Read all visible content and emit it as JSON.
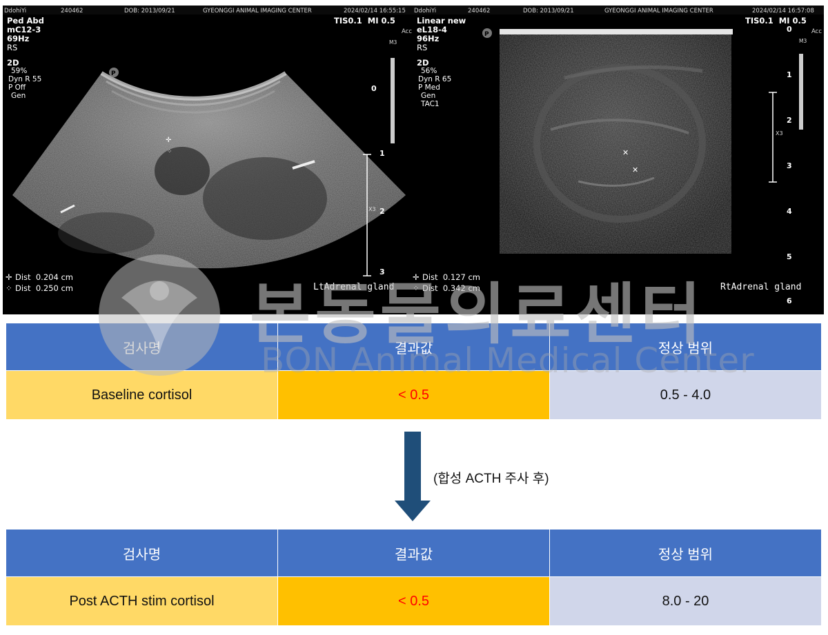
{
  "ultrasound_left": {
    "patient": "DdohiYi",
    "id": "240462",
    "dob": "DOB: 2013/09/21",
    "center": "GYEONGGI ANIMAL IMAGING CENTER",
    "timestamp": "2024/02/14 16:55:15",
    "preset": "Ped Abd",
    "probe": "mC12-3",
    "frame_rate": "69Hz",
    "orientation": "RS",
    "mode": "2D",
    "gain": "59%",
    "dyn_range": "Dyn R 55",
    "p_setting": "P Off",
    "gen": "Gen",
    "tis_mi": "TIS0.1  MI 0.5",
    "acc": "Acc",
    "map": "M3",
    "dist1": "Dist  0.204 cm",
    "dist2": "Dist  0.250 cm",
    "label": "LtAdrenal gland",
    "scale_ticks": [
      "0",
      "1",
      "2",
      "3"
    ],
    "zoom_marker": "X3"
  },
  "ultrasound_right": {
    "patient": "DdohiYi",
    "id": "240462",
    "dob": "DOB: 2013/09/21",
    "center": "GYEONGGI ANIMAL IMAGING CENTER",
    "timestamp": "2024/02/14 16:57:08",
    "preset": "Linear new",
    "probe": "eL18-4",
    "frame_rate": "96Hz",
    "orientation": "RS",
    "mode": "2D",
    "gain": "56%",
    "dyn_range": "Dyn R 65",
    "p_setting": "P Med",
    "gen": "Gen",
    "tac": "TAC1",
    "tis_mi": "TIS0.1  MI 0.5",
    "acc": "Acc",
    "map": "M3",
    "dist1": "Dist  0.127 cm",
    "dist2": "Dist  0.342 cm",
    "label": "RtAdrenal gland",
    "scale_ticks": [
      "0",
      "1",
      "2",
      "3",
      "4",
      "5",
      "6"
    ],
    "zoom_marker": "X3"
  },
  "watermark": {
    "korean": "본동물의료센터",
    "english": "BON Animal Medical Center"
  },
  "table1": {
    "headers": [
      "검사명",
      "결과값",
      "정상 범위"
    ],
    "test": "Baseline cortisol",
    "result": "< 0.5",
    "range": "0.5 - 4.0"
  },
  "stim_note": "(합성 ACTH 주사 후)",
  "table2": {
    "headers": [
      "검사명",
      "결과값",
      "정상 범위"
    ],
    "test": "Post ACTH stim cortisol",
    "result": "< 0.5",
    "range": "8.0 - 20"
  },
  "colors": {
    "header_blue": "#4472c4",
    "test_cell": "#ffd966",
    "result_cell": "#ffc000",
    "result_text": "#ff0000",
    "range_cell": "#d0d6ea",
    "arrow": "#1f4e79"
  }
}
